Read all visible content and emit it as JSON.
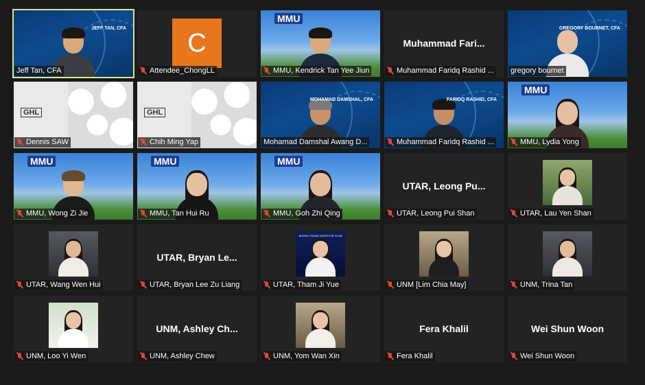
{
  "participants": [
    {
      "name": "Jeff Tan, CFA",
      "muted": false,
      "speaking": true
    },
    {
      "name": "Attendee_ChongLL",
      "muted": true,
      "avatar_letter": "C",
      "avatar_color": "#e8761d"
    },
    {
      "name": "MMU, Kendrick Tan Yee Jiun",
      "muted": true
    },
    {
      "name": "Muhammad Faridq Rashid ...",
      "muted": true,
      "display_text": "Muhammad  Fari..."
    },
    {
      "name": "gregory bournet",
      "muted": false
    },
    {
      "name": "Dennis SAW",
      "muted": true
    },
    {
      "name": "Chih Ming Yap",
      "muted": true
    },
    {
      "name": "Mohamad Damshal Awang D...",
      "muted": false
    },
    {
      "name": "Muhammad Faridq Rashid ...",
      "muted": true
    },
    {
      "name": "MMU, Lydia Yong",
      "muted": true
    },
    {
      "name": "MMU, Wong Zi Jie",
      "muted": true
    },
    {
      "name": "MMU, Tan Hui Ru",
      "muted": true
    },
    {
      "name": "MMU, Goh Zhi Qing",
      "muted": true
    },
    {
      "name": "UTAR, Leong Pui Shan",
      "muted": true,
      "display_text": "UTAR, Leong Pu..."
    },
    {
      "name": "UTAR, Lau Yen Shan",
      "muted": true
    },
    {
      "name": "UTAR, Wang Wen Hui",
      "muted": true
    },
    {
      "name": "UTAR, Bryan Lee Zu Liang",
      "muted": true,
      "display_text": "UTAR, Bryan Le..."
    },
    {
      "name": "UTAR, Tham Ji Yue",
      "muted": true
    },
    {
      "name": "UNM [Lim Chia May]",
      "muted": true
    },
    {
      "name": "UNM, Trina Tan",
      "muted": true
    },
    {
      "name": "UNM, Loo Yi Wen",
      "muted": true
    },
    {
      "name": "UNM, Ashley Chew",
      "muted": true,
      "display_text": "UNM, Ashley Ch..."
    },
    {
      "name": "UNM, Yom Wan Xin",
      "muted": true
    },
    {
      "name": "Fera Khalil",
      "muted": true,
      "display_text": "Fera Khalil"
    },
    {
      "name": "Wei Shun Woon",
      "muted": true,
      "display_text": "Wei Shun Woon"
    }
  ],
  "logos": {
    "mmu": "MMU",
    "ghl": "GHL"
  },
  "slide_captions": {
    "jeff": "JEFF TAN, CFA",
    "gregory": "GREGORY BOURNET, CFA",
    "damshal": "MOHAMAD DAMSHAL, CFA",
    "faridq": "FARIDQ RASHID, CFA"
  },
  "club_caption": "BURSA YOUNG INVESTOR CLUB",
  "colors": {
    "background": "#1a1a1a",
    "tile": "#232323",
    "active_speaker_border": "#d8e88a",
    "muted_icon": "#e0463a"
  }
}
